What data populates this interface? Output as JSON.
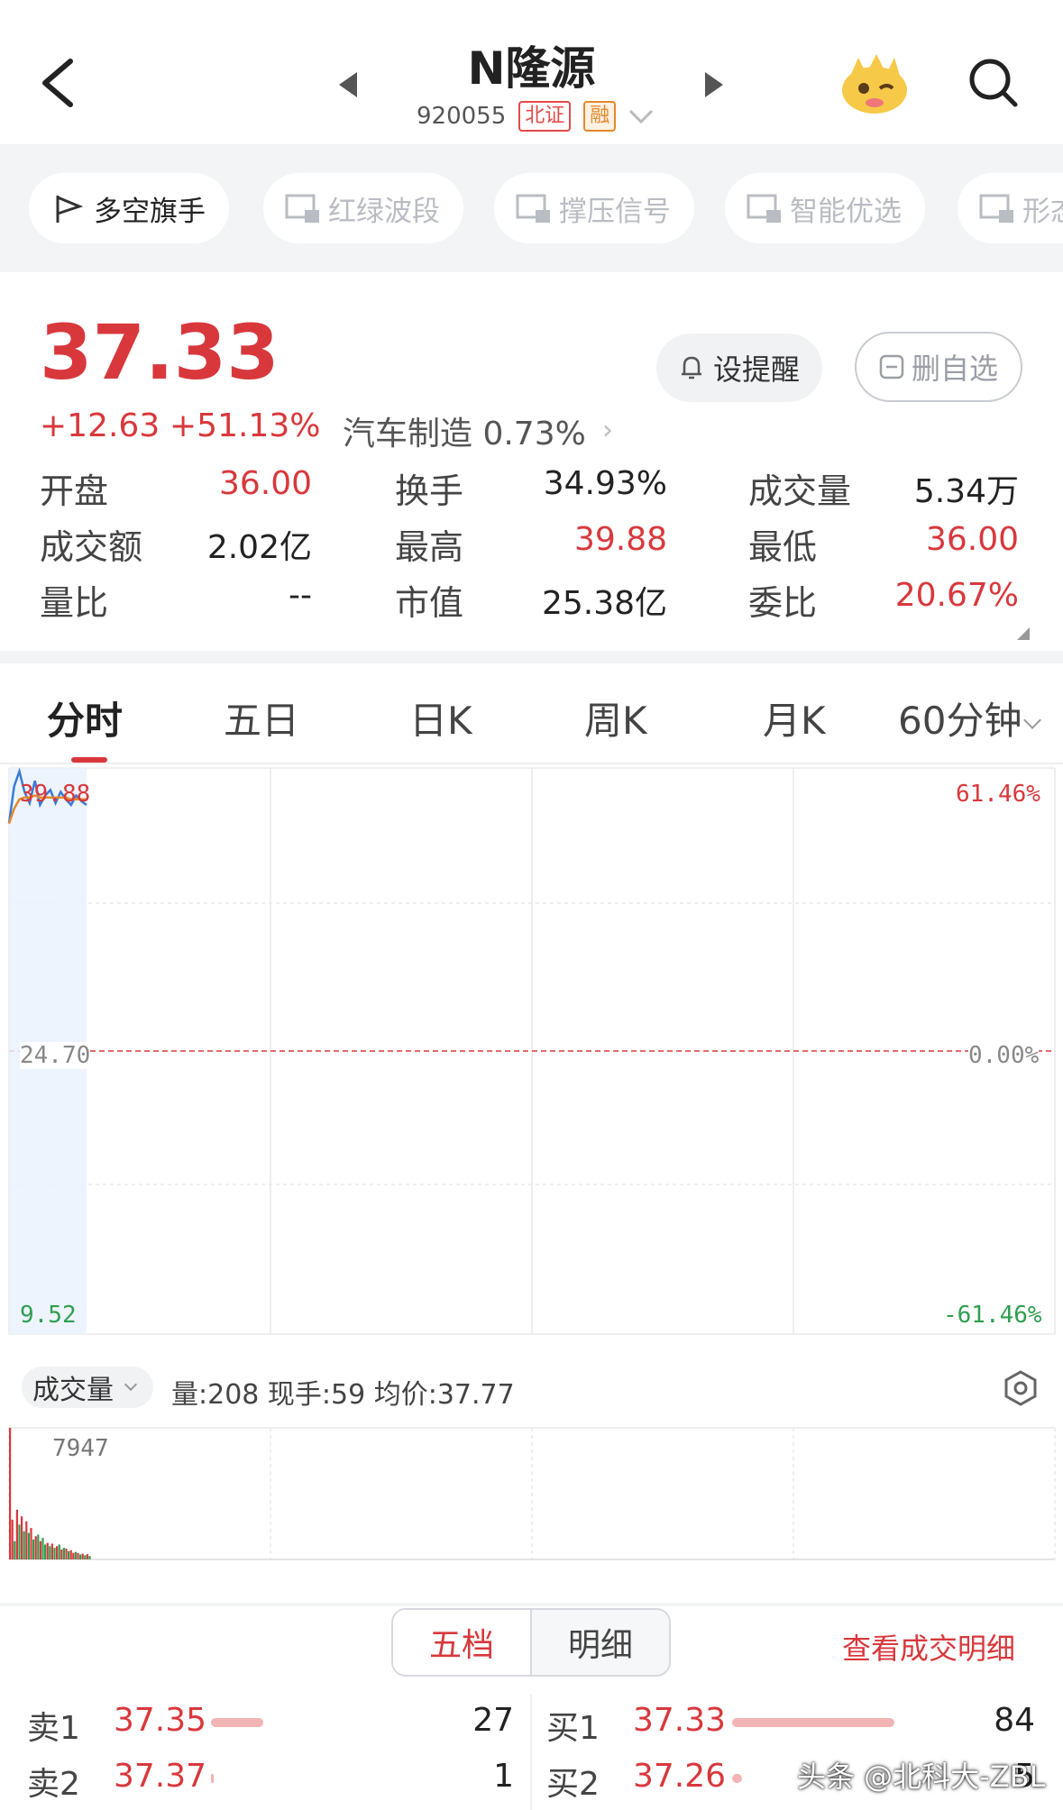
{
  "header": {
    "title": "N隆源",
    "code": "920055",
    "tags": [
      "北证",
      "融"
    ]
  },
  "tools": [
    "多空旗手",
    "红绿波段",
    "撑压信号",
    "智能优选",
    "形态"
  ],
  "quote": {
    "price": "37.33",
    "change": "+12.63",
    "change_pct": "+51.13%",
    "sector": "汽车制造 0.73%",
    "remind_label": "设提醒",
    "delete_watch_label": "删自选",
    "stats": [
      {
        "label": "开盘",
        "value": "36.00"
      },
      {
        "label": "换手",
        "value": "34.93%"
      },
      {
        "label": "成交量",
        "value": "5.34万"
      },
      {
        "label": "成交额",
        "value": "2.02亿"
      },
      {
        "label": "最高",
        "value": "39.88"
      },
      {
        "label": "最低",
        "value": "36.00"
      },
      {
        "label": "量比",
        "value": "--"
      },
      {
        "label": "市值",
        "value": "25.38亿"
      },
      {
        "label": "委比",
        "value": "20.67%"
      }
    ]
  },
  "period_tabs": [
    "分时",
    "五日",
    "日K",
    "周K",
    "月K",
    "60分钟"
  ],
  "chart_labels": {
    "high_price": "39.88",
    "high_pct": "61.46%",
    "base_price": "24.70",
    "base_pct": "0.00%",
    "low_price": "9.52",
    "low_pct": "-61.46%"
  },
  "chart_data": {
    "type": "line",
    "x": [
      0,
      1,
      2,
      3,
      4,
      5,
      6,
      7,
      8,
      9,
      10,
      11,
      12,
      13,
      14,
      15
    ],
    "series": [
      {
        "values": [
          36.9,
          38.9,
          39.7,
          38.6,
          38.0,
          39.2,
          37.9,
          38.4,
          38.7,
          38.0,
          38.6,
          38.2,
          37.9,
          38.4,
          38.1,
          37.9
        ]
      },
      {
        "values": [
          36.9,
          37.7,
          38.2,
          38.3,
          38.3,
          38.4,
          38.3,
          38.3,
          38.3,
          38.3,
          38.3,
          38.3,
          38.2,
          38.2,
          38.2,
          38.2
        ]
      }
    ],
    "ylim": [
      9.52,
      39.88
    ],
    "volume": [
      7947,
      2400,
      1100,
      3000,
      2100,
      2600,
      1700,
      2300,
      1600,
      1900,
      1200,
      1400,
      1500,
      1100,
      1300,
      900,
      1000,
      800,
      950,
      700,
      800,
      900,
      600,
      700,
      650,
      500,
      550,
      400,
      450,
      380,
      300,
      350,
      250,
      320,
      208
    ],
    "volume_colors": [
      "#d8383c",
      "#d8383c",
      "#2f9e4f",
      "#d8383c",
      "#2f9e4f",
      "#d8383c",
      "#2f9e4f",
      "#d8383c",
      "#2f9e4f",
      "#d8383c",
      "#2f9e4f",
      "#d8383c",
      "#2f9e4f",
      "#d8383c",
      "#2f9e4f",
      "#2f9e4f",
      "#d8383c",
      "#2f9e4f",
      "#d8383c",
      "#2f9e4f",
      "#d8383c",
      "#2f9e4f",
      "#d8383c",
      "#2f9e4f",
      "#d8383c",
      "#2f9e4f",
      "#d8383c",
      "#d8383c",
      "#2f9e4f",
      "#d8383c",
      "#2f9e4f",
      "#d8383c",
      "#2f9e4f",
      "#d8383c",
      "#2f9e4f"
    ],
    "volume_max_label": "7947"
  },
  "volume_bar": {
    "tag": "成交量",
    "info": "量:208  现手:59  均价:37.77"
  },
  "orderbook": {
    "tabs": [
      "五档",
      "明细"
    ],
    "view_detail": "查看成交明细",
    "sell": [
      {
        "label": "卖1",
        "price": "37.35",
        "qty": "27",
        "bar": 0.32
      },
      {
        "label": "卖2",
        "price": "37.37",
        "qty": "1",
        "bar": 0.01
      }
    ],
    "buy": [
      {
        "label": "买1",
        "price": "37.33",
        "qty": "84",
        "bar": 1.0
      },
      {
        "label": "买2",
        "price": "37.26",
        "qty": "5",
        "bar": 0.06
      }
    ]
  },
  "watermark": "头条 @北科大-ZBL",
  "colors": {
    "red": "#d8383c",
    "green": "#2f9e4f",
    "blue": "#3a7bd5",
    "orange": "#e38a2d"
  }
}
